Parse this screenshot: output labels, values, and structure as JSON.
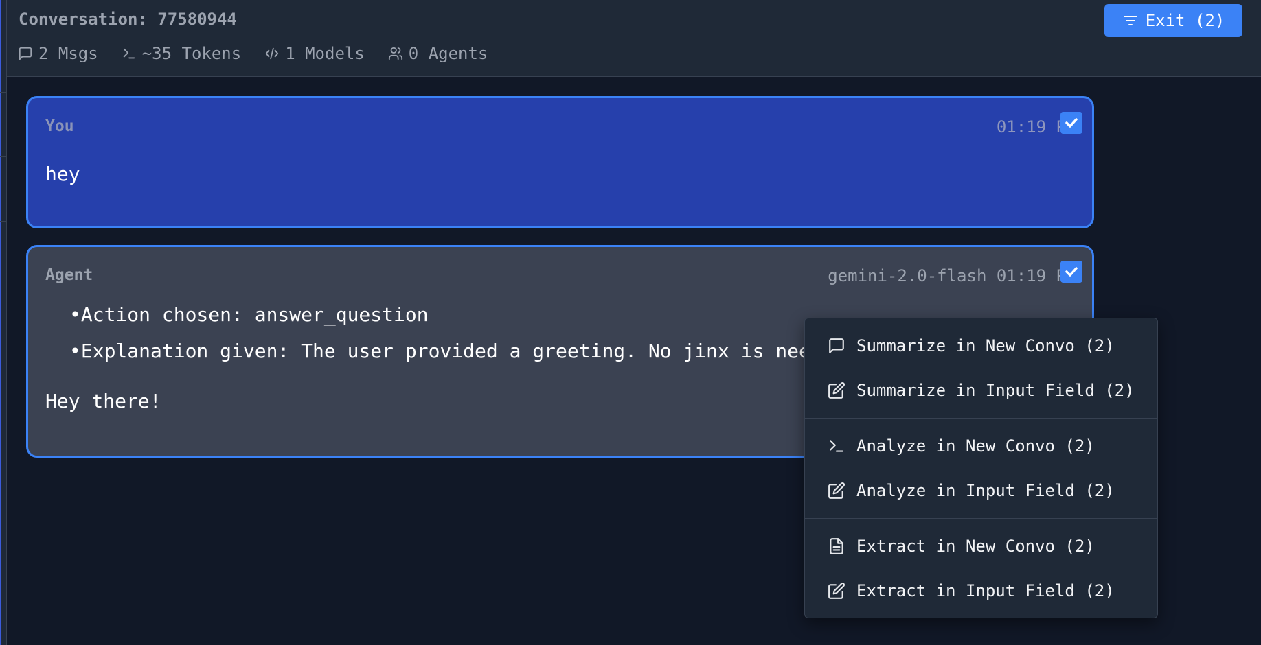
{
  "header": {
    "title": "Conversation: 77580944",
    "stats": {
      "msgs": "2 Msgs",
      "tokens": "~35 Tokens",
      "models": "1 Models",
      "agents": "0 Agents"
    },
    "exit_label": "Exit (2)"
  },
  "messages": {
    "user": {
      "sender": "You",
      "time": "01:19 P",
      "text": "hey",
      "selected": true
    },
    "agent": {
      "sender": "Agent",
      "meta": "gemini-2.0-flash 01:19 P",
      "bullets": [
        "•Action chosen: answer_question",
        "•Explanation given: The user provided a greeting. No jinx is needed."
      ],
      "text": "Hey there!",
      "selected": true
    }
  },
  "context_menu": {
    "items": [
      {
        "label": "Summarize in New Convo (2)",
        "icon": "message-square-icon"
      },
      {
        "label": "Summarize in Input Field (2)",
        "icon": "edit-icon"
      },
      {
        "label": "Analyze in New Convo (2)",
        "icon": "terminal-icon"
      },
      {
        "label": "Analyze in Input Field (2)",
        "icon": "edit-icon"
      },
      {
        "label": "Extract in New Convo (2)",
        "icon": "file-text-icon"
      },
      {
        "label": "Extract in Input Field (2)",
        "icon": "edit-icon"
      }
    ]
  },
  "colors": {
    "background": "#111827",
    "header": "#1f2937",
    "accent": "#3b82f6",
    "user_bubble": "#2640ac",
    "agent_bubble": "#3b4252"
  }
}
